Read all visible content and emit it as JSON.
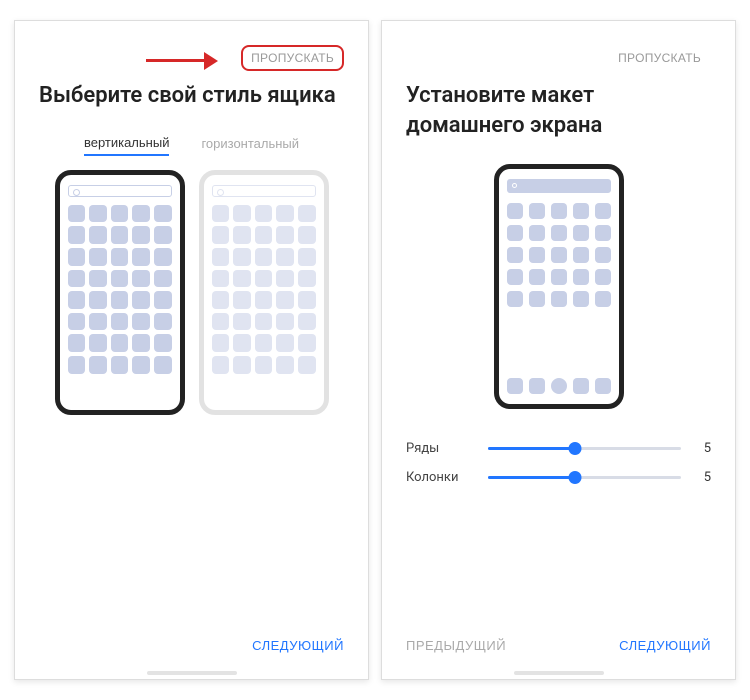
{
  "left": {
    "skip_label": "ПРОПУСКАТЬ",
    "title": "Выберите свой стиль ящика",
    "tabs": {
      "vertical": "вертикальный",
      "horizontal": "горизонтальный",
      "active": "vertical"
    },
    "next_label": "СЛЕДУЮЩИЙ"
  },
  "right": {
    "skip_label": "ПРОПУСКАТЬ",
    "title": "Установите макет домашнего экрана",
    "sliders": {
      "rows": {
        "label": "Ряды",
        "value": 5
      },
      "columns": {
        "label": "Колонки",
        "value": 5
      }
    },
    "prev_label": "ПРЕДЫДУЩИЙ",
    "next_label": "СЛЕДУЮЩИЙ"
  },
  "colors": {
    "accent": "#2176ff",
    "highlight": "#d62828"
  }
}
